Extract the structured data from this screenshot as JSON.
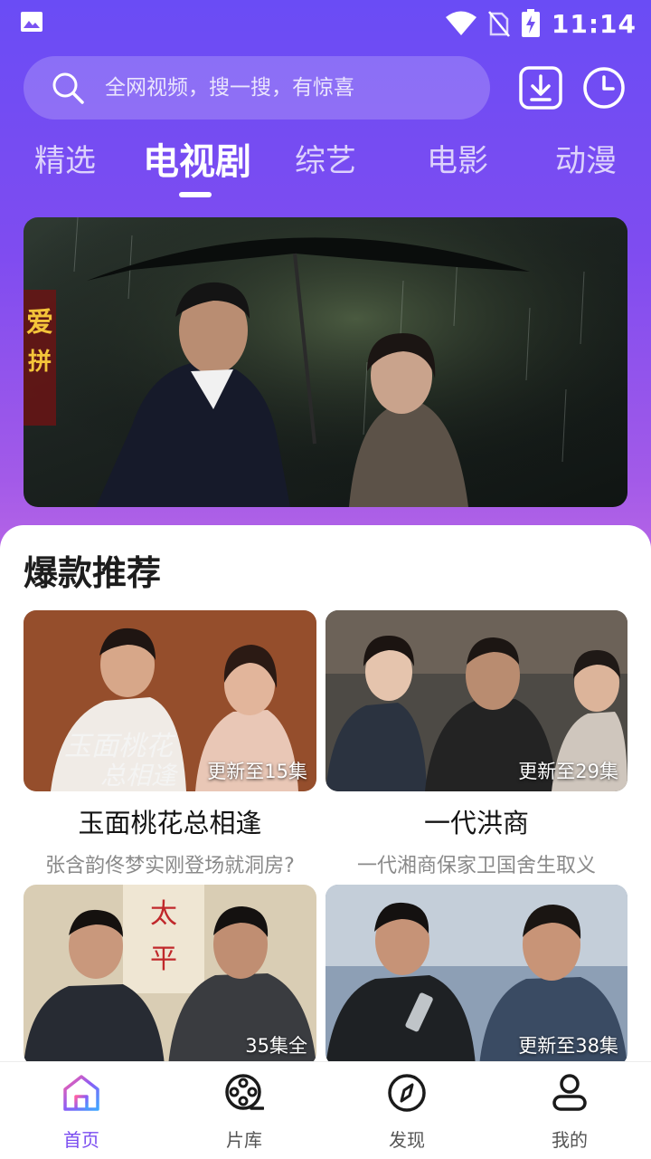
{
  "status_bar": {
    "time": "11:14"
  },
  "search": {
    "placeholder": "全网视频，搜一搜，有惊喜"
  },
  "tabs": [
    {
      "label": "精选"
    },
    {
      "label": "电视剧",
      "active": true
    },
    {
      "label": "综艺"
    },
    {
      "label": "电影"
    },
    {
      "label": "动漫"
    }
  ],
  "banner": {
    "side_text": "爱拼"
  },
  "section": {
    "title": "爆款推荐",
    "cards": [
      {
        "title": "玉面桃花总相逢",
        "subtitle": "张含韵佟梦实刚登场就洞房?",
        "badge": "更新至15集",
        "poster_text": "玉面桃花总相逢"
      },
      {
        "title": "一代洪商",
        "subtitle": "一代湘商保家卫国舍生取义",
        "badge": "更新至29集"
      },
      {
        "title": "",
        "subtitle": "",
        "badge": "35集全",
        "poster_text": "太平"
      },
      {
        "title": "",
        "subtitle": "",
        "badge": "更新至38集"
      }
    ]
  },
  "bottom_nav": [
    {
      "label": "首页",
      "icon": "home-icon",
      "active": true
    },
    {
      "label": "片库",
      "icon": "film-reel-icon"
    },
    {
      "label": "发现",
      "icon": "compass-icon"
    },
    {
      "label": "我的",
      "icon": "user-icon"
    }
  ],
  "colors": {
    "accent": "#7a4cf0",
    "header_top": "#6a4cf5",
    "header_bottom": "#b865e6"
  }
}
